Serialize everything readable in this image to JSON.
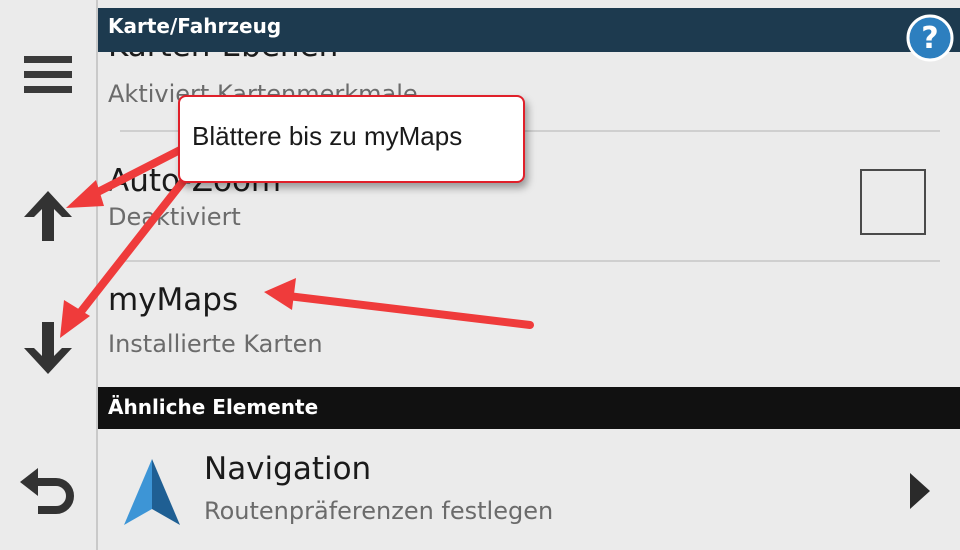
{
  "header": {
    "title": "Karte/Fahrzeug",
    "help_icon": "help-icon"
  },
  "sidebar": {
    "icons": [
      "menu-icon",
      "arrow-up-icon",
      "arrow-down-icon",
      "back-icon"
    ]
  },
  "settings": [
    {
      "title": "Karten-Ebenen",
      "subtitle": "Aktiviert Kartenmerkmale"
    },
    {
      "title": "Auto-Zoom",
      "subtitle": "Deaktiviert",
      "checked": false
    },
    {
      "title": "myMaps",
      "subtitle": "Installierte Karten"
    }
  ],
  "section": {
    "title": "Ähnliche Elemente"
  },
  "related": [
    {
      "title": "Navigation",
      "subtitle": "Routenpräferenzen festlegen",
      "icon": "navigation-arrow-icon"
    }
  ],
  "annotation": {
    "callout_text": "Blättere bis zu myMaps",
    "color": "#ef3b3b"
  },
  "colors": {
    "header_bg": "#1d3a4f",
    "section_bg": "#111111",
    "panel_bg": "#ebebeb",
    "nav_icon_blue": "#2d7fbf"
  }
}
